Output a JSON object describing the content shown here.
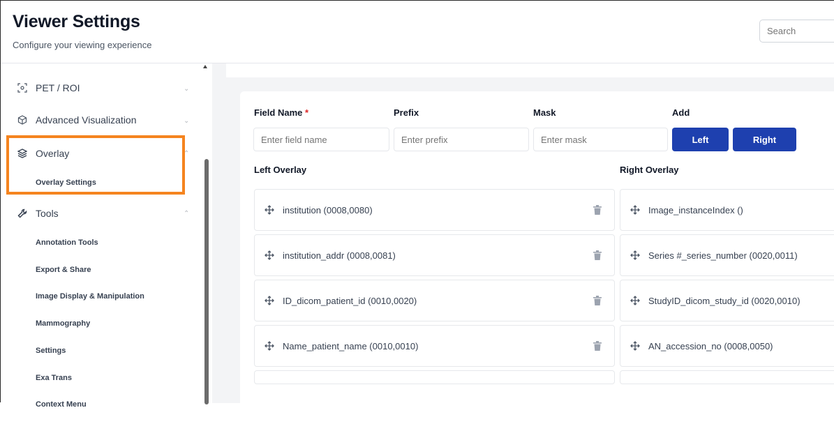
{
  "header": {
    "title": "Viewer Settings",
    "subtitle": "Configure your viewing experience",
    "search_placeholder": "Search"
  },
  "sidebar": {
    "items": [
      {
        "label": "PET / ROI",
        "icon": "scan-icon"
      },
      {
        "label": "Advanced Visualization",
        "icon": "cube-icon"
      },
      {
        "label": "Overlay",
        "icon": "layers-icon",
        "sub": [
          "Overlay Settings"
        ]
      },
      {
        "label": "Tools",
        "icon": "wrench-icon",
        "sub": [
          "Annotation Tools",
          "Export & Share",
          "Image Display & Manipulation",
          "Mammography",
          "Settings",
          "Exa Trans",
          "Context Menu"
        ]
      }
    ]
  },
  "form": {
    "field_name_label": "Field Name",
    "required_mark": "*",
    "prefix_label": "Prefix",
    "mask_label": "Mask",
    "add_label": "Add",
    "field_name_placeholder": "Enter field name",
    "prefix_placeholder": "Enter prefix",
    "mask_placeholder": "Enter mask",
    "left_button": "Left",
    "right_button": "Right"
  },
  "overlays": {
    "left_title": "Left Overlay",
    "right_title": "Right Overlay",
    "left": [
      "institution (0008,0080)",
      "institution_addr (0008,0081)",
      "ID_dicom_patient_id (0010,0020)",
      "Name_patient_name (0010,0010)"
    ],
    "right": [
      "Image_instanceIndex ()",
      "Series #_series_number (0020,0011)",
      "StudyID_dicom_study_id (0020,0010)",
      "AN_accession_no (0008,0050)"
    ]
  },
  "colors": {
    "accent": "#1e40af",
    "highlight": "#f5841f",
    "required": "#dc2626"
  }
}
